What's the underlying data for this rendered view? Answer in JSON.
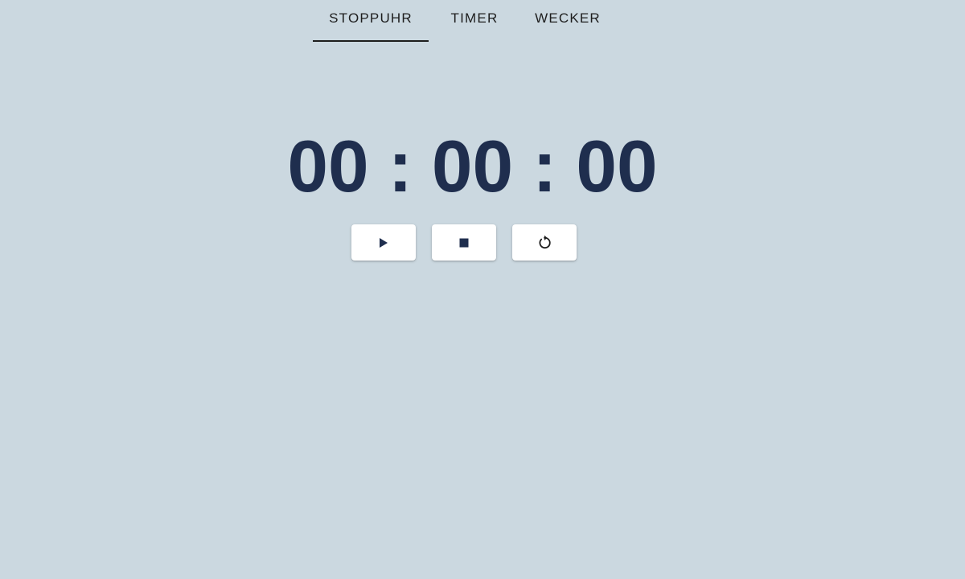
{
  "tabs": [
    {
      "label": "STOPPUHR",
      "active": true
    },
    {
      "label": "TIMER",
      "active": false
    },
    {
      "label": "WECKER",
      "active": false
    }
  ],
  "clock": {
    "hours": "00",
    "minutes": "00",
    "seconds": "00",
    "separator": ":"
  },
  "controls": [
    {
      "icon": "play-icon"
    },
    {
      "icon": "stop-icon"
    },
    {
      "icon": "reset-icon"
    }
  ],
  "colors": {
    "background": "#cbd8e0",
    "clock_text": "#1f2e4e",
    "tab_text": "#1e1e1e",
    "button_background": "#ffffff"
  }
}
